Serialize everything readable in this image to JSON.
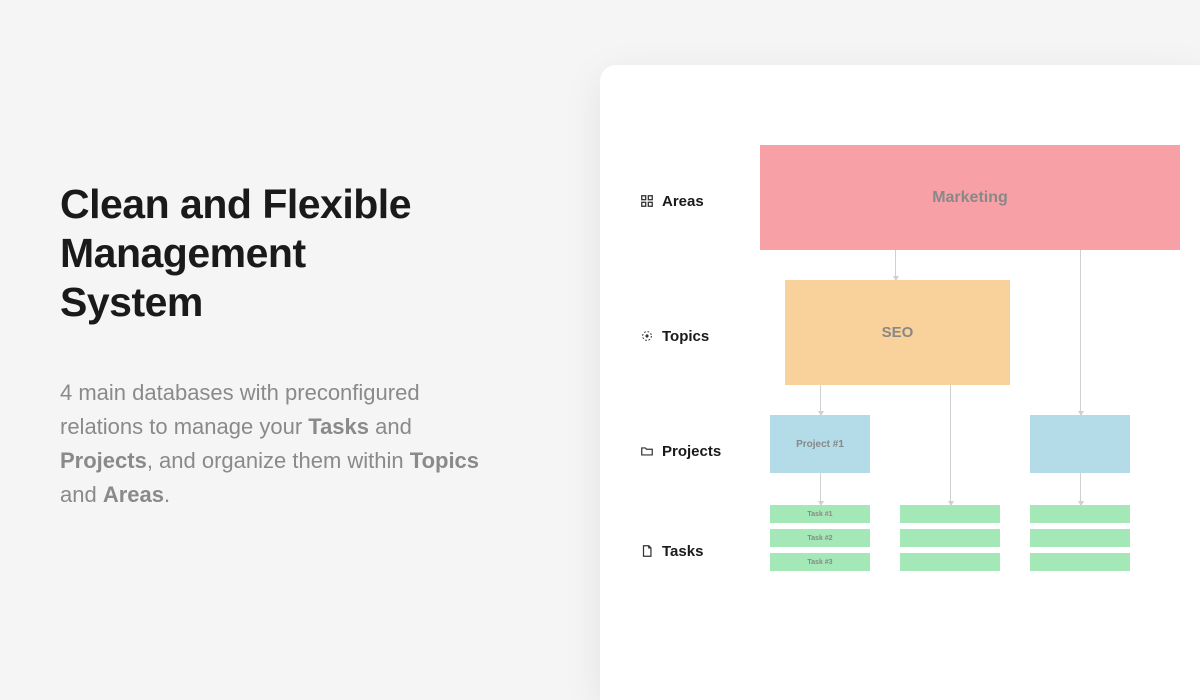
{
  "heading_line1": "Clean and Flexible",
  "heading_line2": "Management",
  "heading_line3": "System",
  "description_parts": {
    "p1": "4 main databases with preconfigured relations to manage your ",
    "b1": "Tasks",
    "p2": " and ",
    "b2": "Projects",
    "p3": ", and organize them within ",
    "b3": "Topics",
    "p4": " and ",
    "b4": "Areas",
    "p5": "."
  },
  "labels": {
    "areas": "Areas",
    "topics": "Topics",
    "projects": "Projects",
    "tasks": "Tasks"
  },
  "diagram": {
    "area": "Marketing",
    "topic": "SEO",
    "projects": [
      "Project #1",
      ""
    ],
    "tasks_col1": [
      "Task #1",
      "Task #2",
      "Task #3"
    ],
    "tasks_col2": [
      "",
      "",
      ""
    ],
    "tasks_col3": [
      "",
      "",
      ""
    ]
  },
  "colors": {
    "area": "#f7a1a7",
    "topic": "#f9d19a",
    "project": "#b3dbe8",
    "task": "#a3e8b6"
  }
}
